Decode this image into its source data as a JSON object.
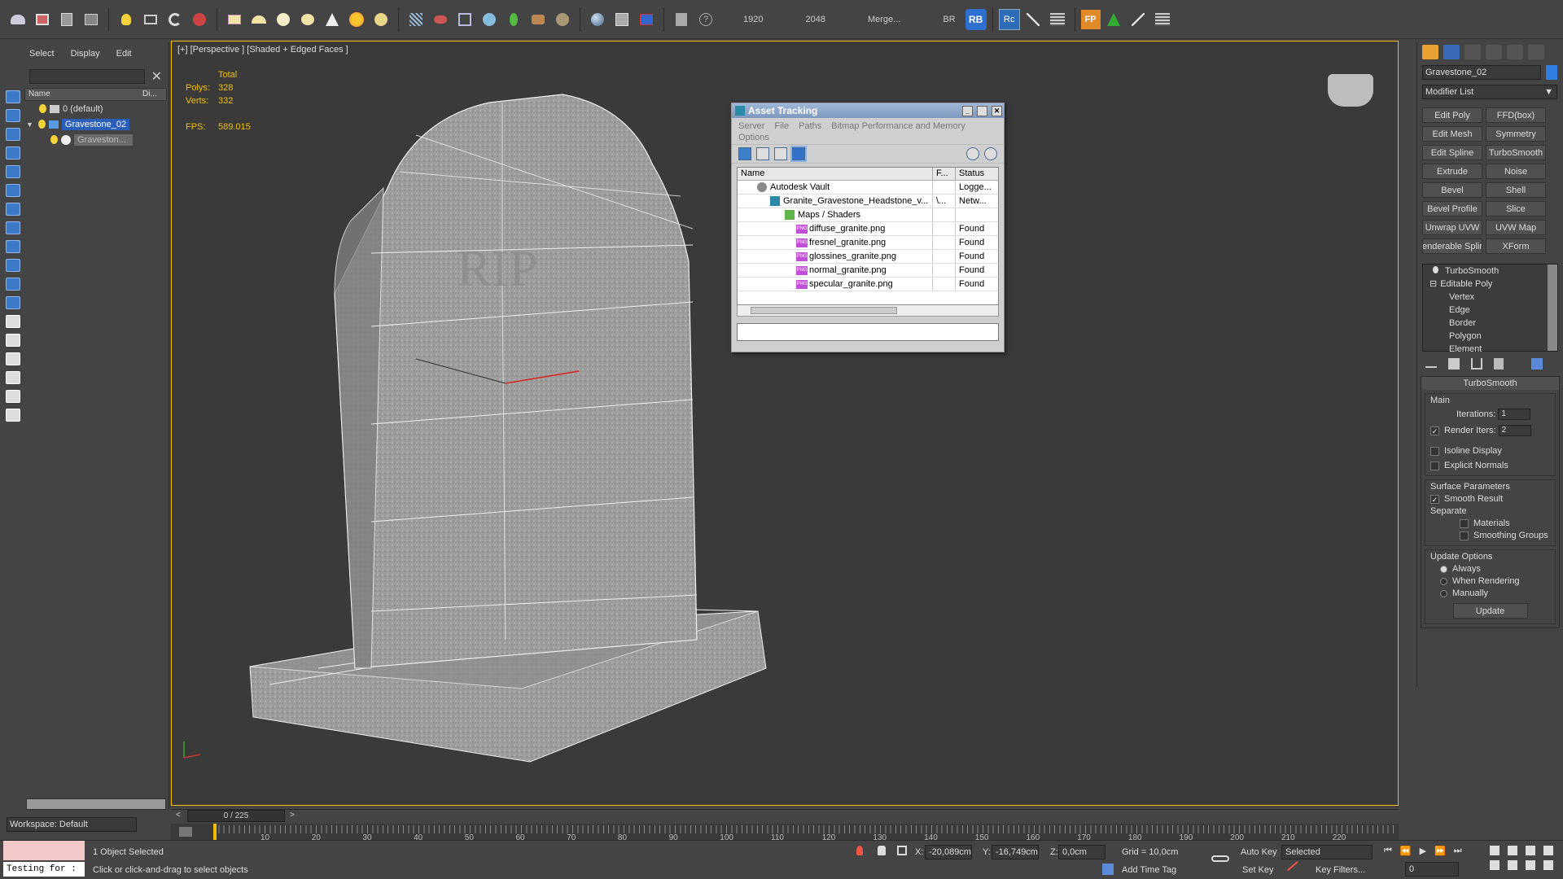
{
  "toolbar": {
    "res_w": "1920",
    "res_h": "2048",
    "merge": "Merge...",
    "br": "BR",
    "rb": "RB",
    "rc": "Rc",
    "fp": "FP"
  },
  "scene": {
    "menu": [
      "Select",
      "Display",
      "Edit"
    ],
    "col_name": "Name",
    "col_di": "Di...",
    "rows": [
      "0 (default)",
      "Gravestone_02",
      "Graveston..."
    ],
    "workspace": "Workspace: Default"
  },
  "viewport": {
    "label": "[+] [Perspective ] [Shaded + Edged Faces ]",
    "total_label": "Total",
    "polys_label": "Polys:",
    "polys": "328",
    "verts_label": "Verts:",
    "verts": "332",
    "fps_label": "FPS:",
    "fps": "589.015",
    "engraving": "RIP"
  },
  "asset_tracking": {
    "title": "Asset Tracking",
    "menu": [
      "Server",
      "File",
      "Paths",
      "Bitmap Performance and Memory"
    ],
    "options": "Options",
    "headers": [
      "Name",
      "F...",
      "Status"
    ],
    "rows": [
      {
        "name": "Autodesk Vault",
        "f": "",
        "status": "Logge..."
      },
      {
        "name": "Granite_Gravestone_Headstone_v...",
        "f": "\\...",
        "status": "Netw..."
      },
      {
        "name": "Maps / Shaders",
        "f": "",
        "status": ""
      },
      {
        "name": "diffuse_granite.png",
        "f": "",
        "status": "Found"
      },
      {
        "name": "fresnel_granite.png",
        "f": "",
        "status": "Found"
      },
      {
        "name": "glossines_granite.png",
        "f": "",
        "status": "Found"
      },
      {
        "name": "normal_granite.png",
        "f": "",
        "status": "Found"
      },
      {
        "name": "specular_granite.png",
        "f": "",
        "status": "Found"
      }
    ]
  },
  "command_panel": {
    "object_name": "Gravestone_02",
    "modifier_list": "Modifier List",
    "buttons": [
      "Edit Poly",
      "FFD(box)",
      "Edit Mesh",
      "Symmetry",
      "Edit Spline",
      "TurboSmooth",
      "Extrude",
      "Noise",
      "Bevel",
      "Shell",
      "Bevel Profile",
      "Slice",
      "Unwrap UVW",
      "UVW Map",
      "enderable Splir",
      "XForm"
    ],
    "stack": [
      "TurboSmooth",
      "Editable Poly",
      "Vertex",
      "Edge",
      "Border",
      "Polygon",
      "Element"
    ],
    "rollout_title": "TurboSmooth",
    "main": "Main",
    "iterations_label": "Iterations:",
    "iterations": "1",
    "render_iters_label": "Render Iters:",
    "render_iters": "2",
    "isoline": "Isoline Display",
    "explicit_normals": "Explicit Normals",
    "surface_params": "Surface Parameters",
    "smooth_result": "Smooth Result",
    "separate": "Separate",
    "materials": "Materials",
    "smoothing_groups": "Smoothing Groups",
    "update_options": "Update Options",
    "always": "Always",
    "when_rendering": "When Rendering",
    "manually": "Manually",
    "update": "Update"
  },
  "timeline": {
    "frame": "0 / 225",
    "ticks": [
      "10",
      "20",
      "30",
      "40",
      "50",
      "60",
      "70",
      "80",
      "90",
      "100",
      "110",
      "120",
      "130",
      "140",
      "150",
      "160",
      "170",
      "180",
      "190",
      "200",
      "210",
      "220"
    ]
  },
  "status": {
    "script": "Testing for :",
    "selected": "1 Object Selected",
    "hint": "Click or click-and-drag to select objects",
    "x_label": "X:",
    "x": "-20,089cm",
    "y_label": "Y:",
    "y": "-16,749cm",
    "z_label": "Z:",
    "z": "0,0cm",
    "grid": "Grid = 10,0cm",
    "add_time_tag": "Add Time Tag",
    "auto_key": "Auto Key",
    "set_key": "Set Key",
    "selected_dd": "Selected",
    "key_filters": "Key Filters...",
    "frame_field": "0"
  }
}
